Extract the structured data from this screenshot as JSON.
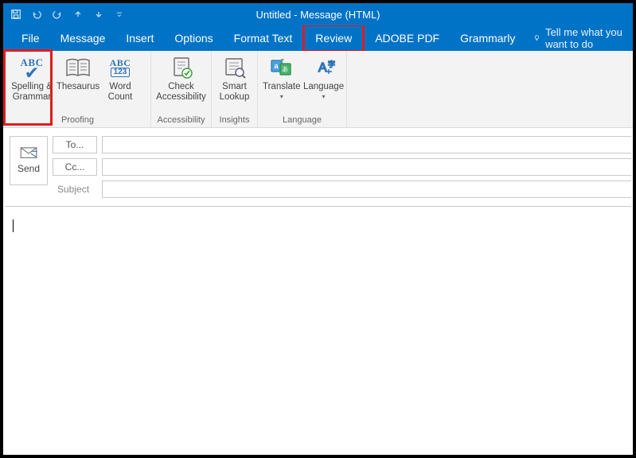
{
  "window": {
    "title": "Untitled  -  Message (HTML)"
  },
  "qat": {
    "save": "save-icon",
    "undo": "undo-icon",
    "redo": "redo-icon",
    "up": "up-icon",
    "down": "down-icon",
    "more": "more-icon"
  },
  "tabs": {
    "file": "File",
    "message": "Message",
    "insert": "Insert",
    "options": "Options",
    "format_text": "Format Text",
    "review": "Review",
    "adobe_pdf": "ADOBE PDF",
    "grammarly": "Grammarly",
    "tellme": "Tell me what you want to do"
  },
  "ribbon": {
    "proofing": {
      "label": "Proofing",
      "spelling": {
        "line1": "Spelling &",
        "line2": "Grammar"
      },
      "thesaurus": {
        "line1": "Thesaurus"
      },
      "word_count": {
        "line1": "Word",
        "line2": "Count"
      }
    },
    "accessibility": {
      "label": "Accessibility",
      "check": {
        "line1": "Check",
        "line2": "Accessibility"
      }
    },
    "insights": {
      "label": "Insights",
      "lookup": {
        "line1": "Smart",
        "line2": "Lookup"
      }
    },
    "language": {
      "label": "Language",
      "translate": {
        "line1": "Translate"
      },
      "language": {
        "line1": "Language"
      }
    }
  },
  "compose": {
    "send": "Send",
    "to": "To...",
    "cc": "Cc...",
    "subject_label": "Subject",
    "to_value": "",
    "cc_value": "",
    "subject_value": "",
    "body_value": ""
  }
}
